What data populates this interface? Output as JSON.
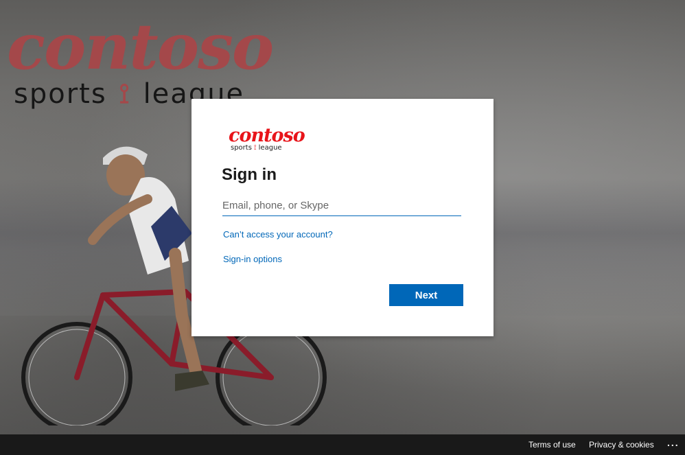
{
  "background": {
    "logo_text": "contoso",
    "logo_subtext_left": "sports",
    "logo_subtext_right": "league"
  },
  "card": {
    "logo": {
      "text": "contoso",
      "subtext_left": "sports",
      "subtext_right": "league",
      "color": "#e8141a"
    },
    "title": "Sign in",
    "email_placeholder": "Email, phone, or Skype",
    "email_value": "",
    "cant_access_link": "Can’t access your account?",
    "signin_options_link": "Sign-in options",
    "next_button": "Next",
    "accent_color": "#0067b8"
  },
  "footer": {
    "terms": "Terms of use",
    "privacy": "Privacy & cookies",
    "more": "..."
  }
}
